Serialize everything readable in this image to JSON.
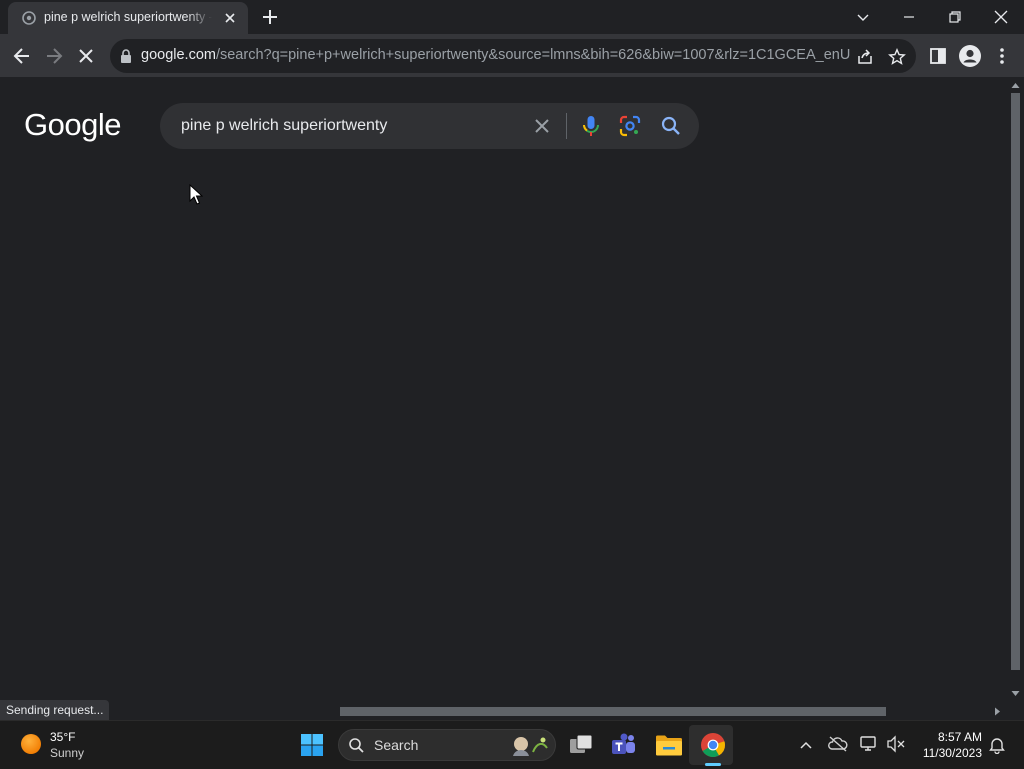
{
  "tab": {
    "title": "pine p welrich superiortwenty - Google Search"
  },
  "address_bar": {
    "host": "google.com",
    "path": "/search?q=pine+p+welrich+superiortwenty&source=lmns&bih=626&biw=1007&rlz=1C1GCEA_enU..."
  },
  "page": {
    "logo": "Google",
    "search_query": "pine p welrich superiortwenty"
  },
  "status_bar": {
    "text": "Sending request..."
  },
  "taskbar": {
    "weather_temp": "35°F",
    "weather_condition": "Sunny",
    "search_label": "Search",
    "time": "8:57 AM",
    "date": "11/30/2023"
  },
  "colors": {
    "background": "#202124",
    "toolbar": "#35363a",
    "searchbox": "#303134",
    "taskbar": "#1c1c1c",
    "accent": "#8ab4f8"
  },
  "icons": [
    "google-favicon-icon",
    "tab-close-icon",
    "new-tab-icon",
    "tab-search-icon",
    "minimize-icon",
    "restore-icon",
    "window-close-icon",
    "back-icon",
    "forward-icon",
    "stop-loading-icon",
    "lock-icon",
    "share-icon",
    "bookmark-star-icon",
    "side-panel-icon",
    "profile-icon",
    "menu-icon",
    "clear-search-icon",
    "microphone-icon",
    "google-lens-icon",
    "search-icon",
    "windows-start-icon",
    "task-view-icon",
    "teams-icon",
    "file-explorer-icon",
    "chrome-icon",
    "show-hidden-icons-icon",
    "onedrive-icon",
    "network-icon",
    "volume-icon",
    "notification-bell-icon",
    "mouse-cursor-icon"
  ]
}
